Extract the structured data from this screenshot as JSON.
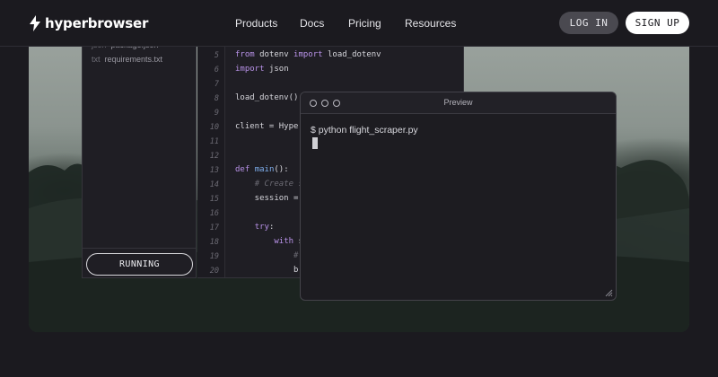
{
  "nav": {
    "brand": "hyperbrowser",
    "links": [
      "Products",
      "Docs",
      "Pricing",
      "Resources"
    ],
    "login_label": "LOG IN",
    "signup_label": "SIGN UP"
  },
  "files": [
    {
      "ext": "json",
      "name": "package.json"
    },
    {
      "ext": "txt",
      "name": "requirements.txt"
    }
  ],
  "run_status_label": "RUNNING",
  "editor": {
    "lines": [
      {
        "no": "5",
        "tokens": [
          {
            "t": "from",
            "c": "kw"
          },
          {
            "t": " dotenv "
          },
          {
            "t": "import",
            "c": "kw"
          },
          {
            "t": " load_dotenv"
          }
        ]
      },
      {
        "no": "6",
        "tokens": [
          {
            "t": "import",
            "c": "kw"
          },
          {
            "t": " json"
          }
        ]
      },
      {
        "no": "7",
        "tokens": []
      },
      {
        "no": "8",
        "tokens": [
          {
            "t": "load_dotenv()"
          }
        ]
      },
      {
        "no": "9",
        "tokens": []
      },
      {
        "no": "10",
        "tokens": [
          {
            "t": "client = Hyperb"
          }
        ]
      },
      {
        "no": "11",
        "tokens": []
      },
      {
        "no": "12",
        "tokens": []
      },
      {
        "no": "13",
        "tokens": [
          {
            "t": "def",
            "c": "kw"
          },
          {
            "t": " "
          },
          {
            "t": "main",
            "c": "fn"
          },
          {
            "t": "():"
          }
        ]
      },
      {
        "no": "14",
        "tokens": [
          {
            "t": "    "
          },
          {
            "t": "# Create se",
            "c": "cm"
          }
        ]
      },
      {
        "no": "15",
        "tokens": [
          {
            "t": "    session = c"
          }
        ]
      },
      {
        "no": "16",
        "tokens": []
      },
      {
        "no": "17",
        "tokens": [
          {
            "t": "    "
          },
          {
            "t": "try",
            "c": "kw"
          },
          {
            "t": ":"
          }
        ]
      },
      {
        "no": "18",
        "tokens": [
          {
            "t": "        "
          },
          {
            "t": "with",
            "c": "kw"
          },
          {
            "t": " sy"
          }
        ]
      },
      {
        "no": "19",
        "tokens": [
          {
            "t": "            "
          },
          {
            "t": "# C",
            "c": "cm"
          }
        ]
      },
      {
        "no": "20",
        "tokens": [
          {
            "t": "            bro"
          }
        ]
      }
    ]
  },
  "preview": {
    "title": "Preview",
    "command": "$ python flight_scraper.py"
  },
  "colors": {
    "background": "#1b1a1f",
    "keyword": "#b892e8",
    "function": "#7fb0f0",
    "comment": "#6c6b74"
  }
}
